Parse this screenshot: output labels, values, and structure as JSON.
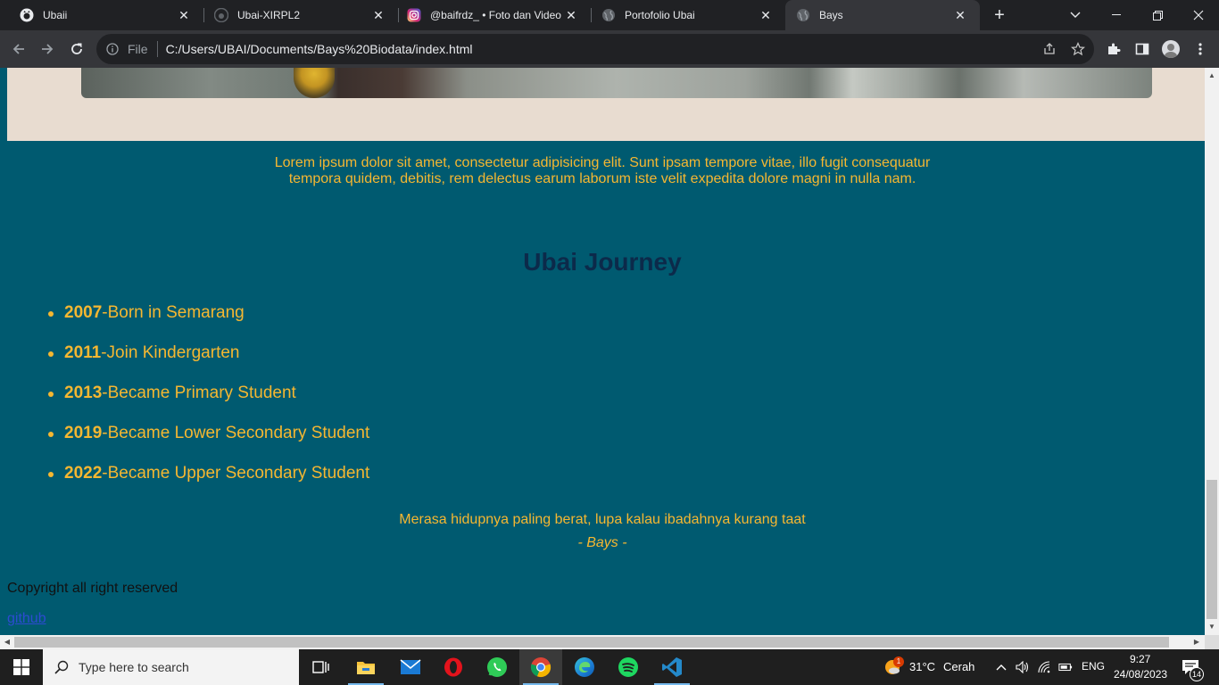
{
  "browser": {
    "tabs": [
      {
        "label": "Ubaii",
        "icon": "github-icon",
        "active": false
      },
      {
        "label": "Ubai-XIRPL2",
        "icon": "github-icon",
        "active": false
      },
      {
        "label": "@baifrdz_ • Foto dan Video I",
        "icon": "instagram-icon",
        "active": false
      },
      {
        "label": "Portofolio Ubai",
        "icon": "globe-icon",
        "active": false
      },
      {
        "label": "Bays",
        "icon": "globe-icon",
        "active": true
      }
    ],
    "omnibox": {
      "scheme_label": "File",
      "url": "C:/Users/UBAI/Documents/Bays%20Biodata/index.html"
    }
  },
  "page": {
    "intro": "Lorem ipsum dolor sit amet, consectetur adipisicing elit. Sunt ipsam tempore vitae, illo fugit consequatur tempora quidem, debitis, rem delectus earum laborum iste velit expedita dolore magni in nulla nam.",
    "journey": {
      "title": "Ubai Journey",
      "items": [
        {
          "year": "2007",
          "text": "-Born in Semarang"
        },
        {
          "year": "2011",
          "text": "-Join Kindergarten"
        },
        {
          "year": "2013",
          "text": "-Became Primary Student"
        },
        {
          "year": "2019",
          "text": "-Became Lower Secondary Student"
        },
        {
          "year": "2022",
          "text": "-Became Upper Secondary Student"
        }
      ]
    },
    "quote": "Merasa hidupnya paling berat, lupa kalau ibadahnya kurang taat",
    "quote_author": "- Bays -",
    "footer": {
      "copyright": "Copyright all right reserved",
      "github_link": "github"
    },
    "colors": {
      "background": "#005a70",
      "accent": "#f5b731",
      "heading": "#0c2a4a",
      "hero_bg": "#e8dcd0"
    }
  },
  "taskbar": {
    "search_placeholder": "Type here to search",
    "apps": [
      "task-view-icon",
      "file-explorer-icon",
      "mail-icon",
      "opera-icon",
      "whatsapp-icon",
      "chrome-icon",
      "edge-icon",
      "spotify-icon",
      "vscode-icon"
    ],
    "weather": {
      "temp": "31°C",
      "condition": "Cerah",
      "badge": "1"
    },
    "language": "ENG",
    "time": "9:27",
    "date": "24/08/2023",
    "notification_count": "14"
  }
}
